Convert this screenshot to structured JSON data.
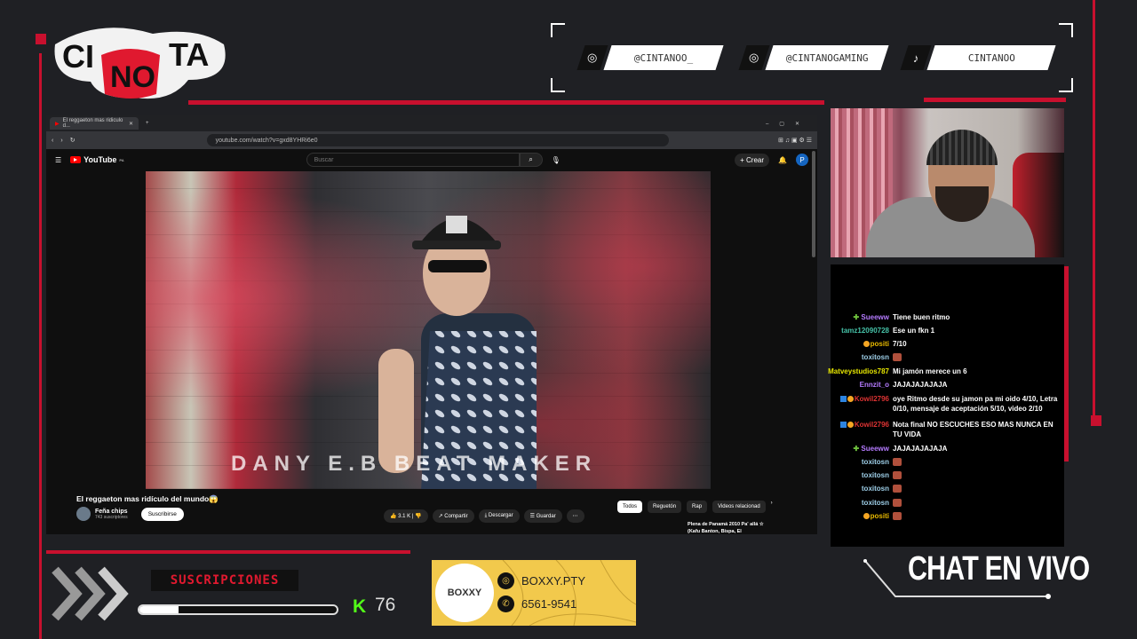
{
  "overlay": {
    "logo_text": "CINTANO",
    "socials": [
      {
        "icon": "instagram-icon",
        "handle": "@CINTANOO_"
      },
      {
        "icon": "instagram-icon",
        "handle": "@CINTANOGAMING"
      },
      {
        "icon": "tiktok-icon",
        "handle": "CINTANOO"
      }
    ],
    "subscriptions_label": "SUSCRIPCIONES",
    "subscriptions_progress": 0.2,
    "kick_count": "76",
    "live_chat_label": "CHAT EN VIVO",
    "colors": {
      "accent": "#c8102e",
      "kick": "#53fc18",
      "ad_bg": "#f2c94c"
    }
  },
  "browser": {
    "tab_title": "El reggaeton mas ridiculo d...",
    "url": "youtube.com/watch?v=gxd8YHRi6e0"
  },
  "youtube": {
    "logo": "YouTube",
    "logo_suffix": "PA",
    "search_placeholder": "Buscar",
    "create_label": "Crear",
    "avatar_letter": "P",
    "video_overlay_text": "DANY E.B BEAT MAKER",
    "video_title": "El reggaeton mas ridículo del mundo😱",
    "channel_name": "Feña chips",
    "channel_subs": "743 suscriptores",
    "subscribe_label": "Suscribirse",
    "likes": "3.1 K",
    "share_label": "Compartir",
    "download_label": "Descargar",
    "save_label": "Guardar",
    "chips": [
      "Todos",
      "Reguetón",
      "Rap",
      "Videos relacionad"
    ],
    "recommended_title": "Plena de Panamá 2010 Pa' allá ☆ (Kafu Banton, Bispa, El"
  },
  "chat": [
    {
      "user": "Sueeww",
      "color": "#b57bff",
      "badge": "gbadge",
      "text": "Tiene buen ritmo"
    },
    {
      "user": "tamz12090728",
      "color": "#46c2a8",
      "badge": "",
      "text": "Ese un fkn 1"
    },
    {
      "user": "positi",
      "color": "#e6b800",
      "badge": "badge",
      "text": "7/10"
    },
    {
      "user": "toxitosn",
      "color": "#9ecfe8",
      "badge": "",
      "text": "",
      "emote": true
    },
    {
      "user": "Matveystudios787",
      "color": "#e6e600",
      "badge": "",
      "text": "Mi jamón merece un 6"
    },
    {
      "user": "Ennzit_o",
      "color": "#b57bff",
      "badge": "",
      "text": "JAJAJAJAJAJA"
    },
    {
      "user": "Kowil2796",
      "color": "#d33",
      "badge": "tw",
      "text": "oye Ritmo desde su jamon pa mi oido 4/10, Letra 0/10, mensaje de aceptación 5/10, video 2/10"
    },
    {
      "user": "Kowil2796",
      "color": "#d33",
      "badge": "tw",
      "text": "Nota final NO ESCUCHES ESO MAS NUNCA EN TU VIDA"
    },
    {
      "user": "Sueeww",
      "color": "#b57bff",
      "badge": "gbadge",
      "text": "JAJAJAJAJAJA"
    },
    {
      "user": "toxitosn",
      "color": "#9ecfe8",
      "badge": "",
      "text": "",
      "emote": true
    },
    {
      "user": "toxitosn",
      "color": "#9ecfe8",
      "badge": "",
      "text": "",
      "emote": true
    },
    {
      "user": "toxitosn",
      "color": "#9ecfe8",
      "badge": "",
      "text": "",
      "emote": true
    },
    {
      "user": "toxitosn",
      "color": "#9ecfe8",
      "badge": "",
      "text": "",
      "emote": true
    },
    {
      "user": "positi",
      "color": "#e6b800",
      "badge": "badge",
      "text": "",
      "emote": true
    }
  ],
  "ad": {
    "brand": "BOXXY",
    "handle": "BOXXY.PTY",
    "phone": "6561-9541"
  }
}
